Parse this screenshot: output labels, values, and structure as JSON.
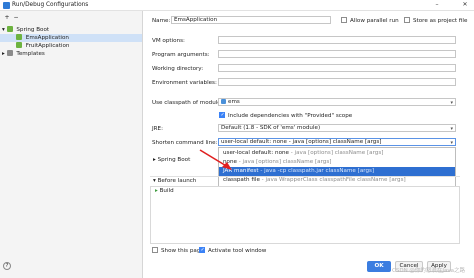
{
  "window": {
    "title": "Run/Debug Configurations"
  },
  "window_controls": {
    "close": "✕"
  },
  "left_toolbar": {
    "add": "+",
    "remove": "−"
  },
  "tree": {
    "spring_boot": "Spring Boot",
    "ems_application": "EmsApplication",
    "fruit_application": "FruitApplication",
    "templates": "Templates"
  },
  "form": {
    "name_label": "Name:",
    "name_value": "EmsApplication",
    "allow_parallel_label": "Allow parallel run",
    "store_as_project_file_label": "Store as project file",
    "vm_options_label": "VM options:",
    "program_arguments_label": "Program arguments:",
    "working_directory_label": "Working directory:",
    "environment_variables_label": "Environment variables:",
    "classpath_module_label": "Use classpath of module:",
    "classpath_module_value": "ems",
    "include_provided_label": "Include dependencies with \"Provided\" scope",
    "jre_label": "JRE:",
    "jre_value": "Default (1.8 - SDK of 'ems' module)",
    "shorten_label": "Shorten command line:",
    "shorten_value": "user-local default: none - java [options] className [args]",
    "spring_boot_section": "Spring Boot",
    "before_launch_label": "Before launch",
    "build_item": "Build",
    "show_page_label": "Show this page",
    "activate_tool_window_label": "Activate tool window"
  },
  "dropdown_options": [
    {
      "main": "user-local default: none",
      "hint": " - java [options] className [args]"
    },
    {
      "main": "none",
      "hint": " - java [options] className [args]"
    },
    {
      "main": "JAR manifest",
      "hint": " - java -cp classpath.jar className [args]"
    },
    {
      "main": "classpath file",
      "hint": " - java WrapperClass classpathFile className [args]"
    }
  ],
  "dropdown_selected_index": 2,
  "buttons": {
    "ok": "OK",
    "cancel": "Cancel",
    "apply": "Apply",
    "help": "?"
  },
  "watermark": "CSDN @你的怒浪在Java之路",
  "colors": {
    "accent": "#2e6fd1",
    "selection_tree": "#cfe1f7",
    "annotation_arrow": "#e02020"
  }
}
